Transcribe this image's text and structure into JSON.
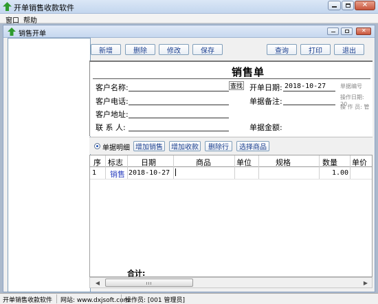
{
  "app": {
    "title": "开单销售收款软件"
  },
  "menu": {
    "items": [
      "窗口",
      "帮助"
    ]
  },
  "child_window": {
    "title": "销售开单"
  },
  "toolbar": {
    "new": "新增",
    "delete": "删除",
    "edit": "修改",
    "save": "保存",
    "query": "查询",
    "print": "打印",
    "exit": "退出"
  },
  "form": {
    "title": "销售单",
    "customer_name_label": "客户名称:",
    "find_button": "查找",
    "customer_phone_label": "客户电话:",
    "customer_address_label": "客户地址:",
    "contact_label": "联 系 人:",
    "date_label": "开单日期:",
    "date_value": "2018-10-27",
    "remark_label": "单据备注:",
    "amount_label": "单据金额:",
    "doc_no_label": "单据编号",
    "op_date_label": "操作日期: 20",
    "operator_label": "操 作 员: 管"
  },
  "detail": {
    "radio_label": "单据明细",
    "add_sale": "增加销售",
    "add_receipt": "增加收款",
    "delete_row": "删除行",
    "choose_product": "选择商品"
  },
  "grid": {
    "headers": [
      "序",
      "标志",
      "日期",
      "商品",
      "单位",
      "规格",
      "数量",
      "单价"
    ],
    "rows": [
      {
        "seq": "1",
        "flag": "销售",
        "date": "2018-10-27",
        "product": "",
        "unit": "",
        "spec": "",
        "qty": "1.00",
        "price": ""
      }
    ],
    "total_label": "合计:"
  },
  "status": {
    "app": "开单销售收款软件",
    "website": "网站: www.dxjsoft.com",
    "operator": "操作员: [001 管理员]"
  },
  "colors": {
    "accent_text": "#1b3f8f",
    "flag_text": "#2a3fbf"
  }
}
